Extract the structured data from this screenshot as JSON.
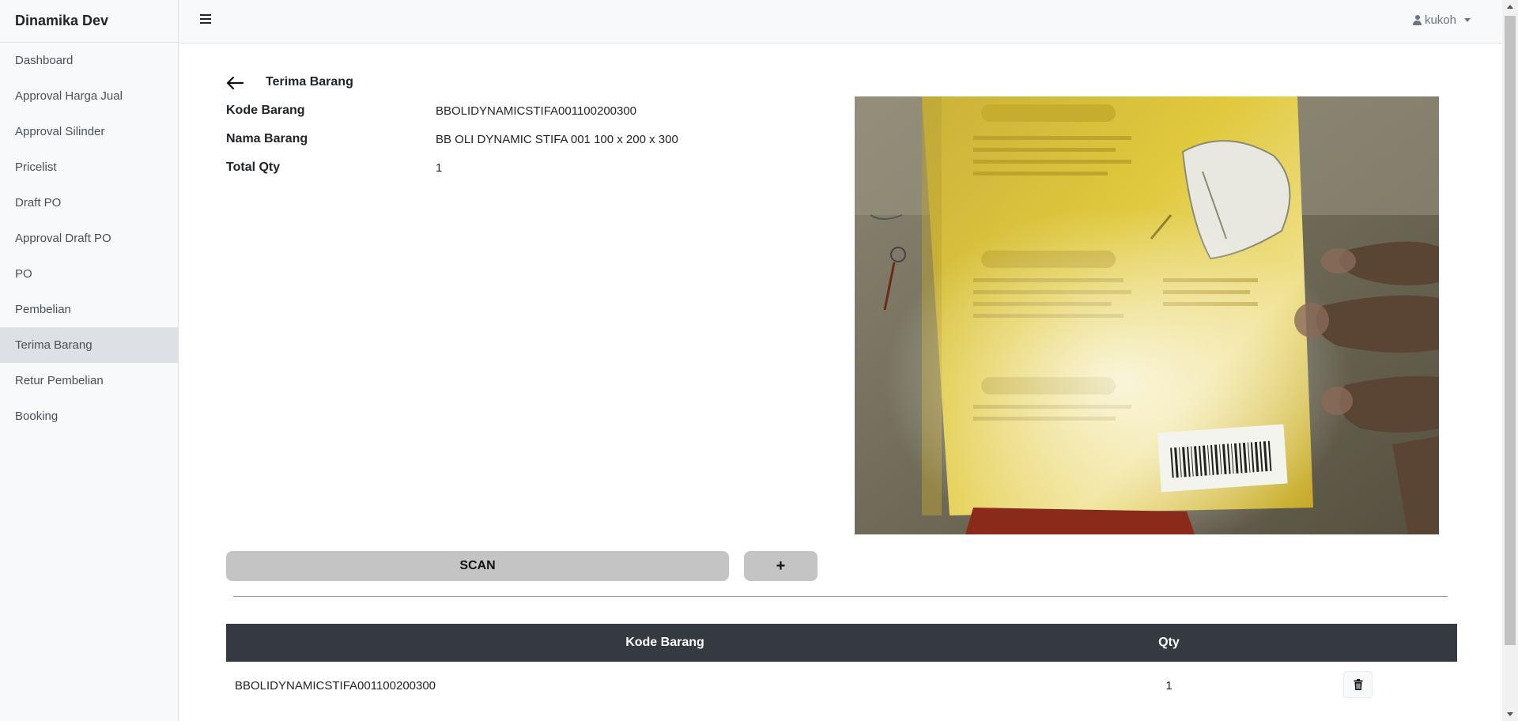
{
  "brand": "Dinamika Dev",
  "sidebar": {
    "items": [
      {
        "label": "Dashboard"
      },
      {
        "label": "Approval Harga Jual"
      },
      {
        "label": "Approval Silinder"
      },
      {
        "label": "Pricelist"
      },
      {
        "label": "Draft PO"
      },
      {
        "label": "Approval Draft PO"
      },
      {
        "label": "PO"
      },
      {
        "label": "Pembelian"
      },
      {
        "label": "Terima Barang",
        "active": true
      },
      {
        "label": "Retur Pembelian"
      },
      {
        "label": "Booking"
      }
    ]
  },
  "topbar": {
    "menu_icon": "hamburger-icon",
    "user_icon": "user-icon",
    "username": "kukoh"
  },
  "page": {
    "title": "Terima Barang",
    "back_icon": "arrow-left-icon"
  },
  "info": {
    "kode_label": "Kode Barang",
    "kode_value": "BBOLIDYNAMICSTIFA001100200300",
    "nama_label": "Nama Barang",
    "nama_value": "BB OLI DYNAMIC STIFA 001 100 x 200 x 300",
    "qty_label": "Total Qty",
    "qty_value": "1"
  },
  "camera": {
    "content": "live-camera-feed"
  },
  "buttons": {
    "scan": "SCAN",
    "add": "+"
  },
  "table": {
    "headers": {
      "kode": "Kode Barang",
      "qty": "Qty"
    },
    "rows": [
      {
        "kode": "BBOLIDYNAMICSTIFA001100200300",
        "qty": "1",
        "action_icon": "trash-icon"
      }
    ]
  },
  "colors": {
    "sidebar_bg": "#f8f9fa",
    "active_item_bg": "#dde1e6",
    "table_header_bg": "#343a40",
    "button_bg": "#c4c4c4"
  }
}
